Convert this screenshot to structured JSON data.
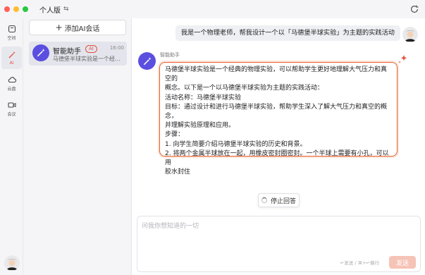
{
  "window": {
    "title": "个人版",
    "switch_glyph": "⇆"
  },
  "rail": {
    "items": [
      {
        "label": "空间",
        "icon": "space-icon"
      },
      {
        "label": "AI",
        "icon": "magic-wand-icon",
        "active": true
      },
      {
        "label": "云盘",
        "icon": "cloud-icon"
      },
      {
        "label": "会议",
        "icon": "video-icon"
      }
    ]
  },
  "sidebar": {
    "add_button": "添加AI会话",
    "conversation": {
      "name": "智能助手",
      "badge": "AI",
      "time": "16:00",
      "preview": "马德堡半球实验是一个经..."
    }
  },
  "chat": {
    "user_message": "我是一个物理老师，帮我设计一个以「马德堡半球实验」为主题的实践活动",
    "bot_name": "智能助手",
    "bot_lines": [
      "马德堡半球实验是一个经典的物理实验，可以帮助学生更好地理解大气压力和真空的",
      "概念。以下是一个以马德堡半球实验为主题的实践活动：",
      "活动名称：马德堡半球实验",
      "目标：通过设计和进行马德堡半球实验，帮助学生深入了解大气压力和真空的概念，",
      "并理解实验原理和应用。",
      "步骤：",
      "1.  向学生简要介绍马德堡半球实验的历史和背景。",
      "2.  将两个金属半球放在一起，用橡皮密封圈密封。一个半球上需要有小孔，可以用",
      "胶水封住"
    ],
    "stop_button": "停止回答"
  },
  "composer": {
    "placeholder": "问我你想知道的一切",
    "hint": "↵发送 / ⌘+↵换行",
    "send_label": "发送"
  },
  "colors": {
    "accent": "#e3503f",
    "assistant_avatar": "#5b4fe0",
    "bubble_border": "#e8632f"
  }
}
